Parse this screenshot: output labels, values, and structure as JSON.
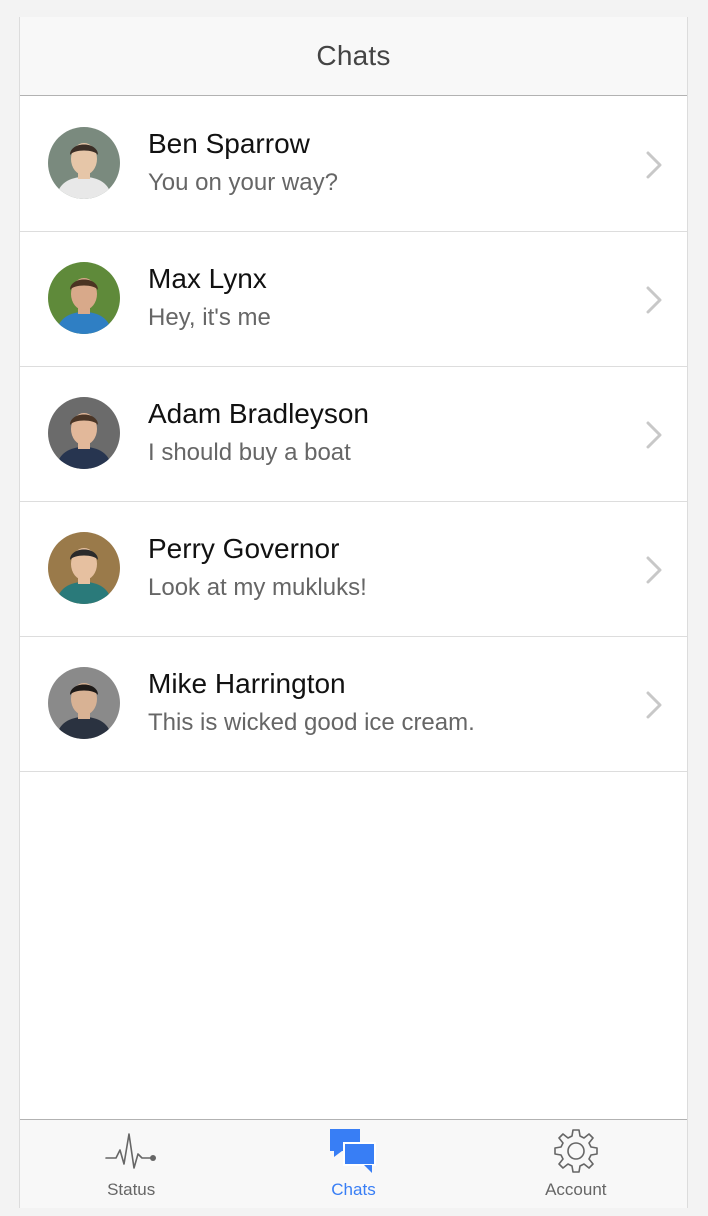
{
  "header": {
    "title": "Chats"
  },
  "chats": [
    {
      "name": "Ben Sparrow",
      "preview": "You on your way?",
      "avatar_colors": {
        "bg": "#7a8a7e",
        "skin": "#e6c6a8",
        "hair": "#3b2e26",
        "shirt": "#e8e8e8"
      }
    },
    {
      "name": "Max Lynx",
      "preview": "Hey, it's me",
      "avatar_colors": {
        "bg": "#5f8a3a",
        "skin": "#d8a98a",
        "hair": "#4a3422",
        "shirt": "#2f7fc4"
      }
    },
    {
      "name": "Adam Bradleyson",
      "preview": "I should buy a boat",
      "avatar_colors": {
        "bg": "#6b6b6b",
        "skin": "#e2b89a",
        "hair": "#4a3526",
        "shirt": "#273550"
      }
    },
    {
      "name": "Perry Governor",
      "preview": "Look at my mukluks!",
      "avatar_colors": {
        "bg": "#9a7a4a",
        "skin": "#e6c0a0",
        "hair": "#2a2a2a",
        "shirt": "#2a7a7a"
      }
    },
    {
      "name": "Mike Harrington",
      "preview": "This is wicked good ice cream.",
      "avatar_colors": {
        "bg": "#8a8a8a",
        "skin": "#d8b294",
        "hair": "#1e1a18",
        "shirt": "#2a3240"
      }
    }
  ],
  "tabs": [
    {
      "label": "Status",
      "icon": "pulse-icon",
      "active": false
    },
    {
      "label": "Chats",
      "icon": "chat-bubbles-icon",
      "active": true
    },
    {
      "label": "Account",
      "icon": "gear-icon",
      "active": false
    }
  ],
  "colors": {
    "accent": "#387ef5",
    "inactive": "#666666",
    "chevron": "#c8c8c8"
  }
}
